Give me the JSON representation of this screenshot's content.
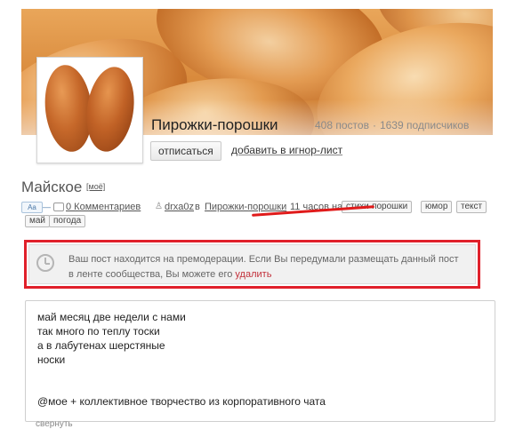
{
  "community": {
    "title": "Пирожки-порошки",
    "posts_count": "408 постов",
    "subscribers_count": "1639 подписчиков",
    "unsubscribe_label": "отписаться",
    "ignore_label": "добавить в игнор-лист"
  },
  "post": {
    "title": "Майское",
    "title_tag": "[моё]",
    "aa_label": "Aa",
    "aa_dash": "—",
    "comments": "0 Комментариев",
    "author": "drxa0z",
    "in_word": "в",
    "community_link": "Пирожки-порошки",
    "time": "11 часов назад",
    "tags": [
      "стихи-порошки",
      "юмор",
      "текст",
      "май",
      "погода"
    ],
    "lines": [
      "май месяц две недели с нами",
      "так много по теплу тоски",
      "а в лабутенах шерстяные",
      "носки"
    ],
    "signature": "@мое + коллективное творчество из корпоративного чата",
    "collapse_label": "свернуть"
  },
  "notice": {
    "text": "Ваш пост находится на премодерации. Если Вы передумали размещать данный пост в ленте сообщества, Вы можете его",
    "delete_label": "удалить"
  },
  "colors": {
    "highlight": "#e0202a",
    "link_red": "#c2303a"
  },
  "icons": [
    "comment-icon",
    "user-icon",
    "clock-icon"
  ]
}
